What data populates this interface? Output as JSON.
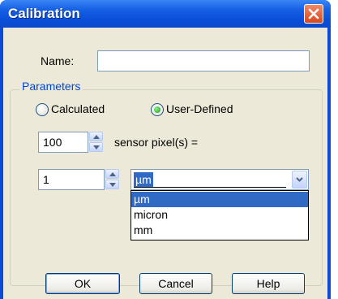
{
  "window": {
    "title": "Calibration"
  },
  "form": {
    "name_label": "Name:",
    "name_value": ""
  },
  "parameters": {
    "legend": "Parameters",
    "radio_calculated": "Calculated",
    "radio_user_defined": "User-Defined",
    "selected_radio": "User-Defined",
    "sensor_pixels_value": "100",
    "sensor_pixels_label": "sensor pixel(s) =",
    "unit_value": "1",
    "unit_selected": "µm",
    "unit_options": [
      "µm",
      "micron",
      "mm"
    ]
  },
  "buttons": {
    "ok": "OK",
    "cancel": "Cancel",
    "help": "Help"
  }
}
